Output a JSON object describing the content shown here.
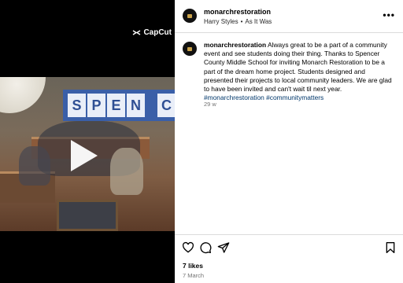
{
  "media": {
    "watermark": "CapCut",
    "banner_letters": [
      "S",
      "P",
      "E",
      "N"
    ],
    "banner_tail": "C",
    "play_icon": "play-icon"
  },
  "header": {
    "username": "monarchrestoration",
    "audio": "Harry Styles",
    "separator": "•",
    "audio_title": "As It Was",
    "more_icon": "more-options-icon"
  },
  "caption": {
    "username": "monarchrestoration",
    "text": "Always great to be a part of a community event and see students doing their thing. Thanks to Spencer County Middle School for inviting Monarch Restoration to be a part of the dream home project. Students designed and presented their projects to local community leaders. We are glad to have been invited and can't wait til next year.",
    "hashtags": [
      "#monarchrestoration",
      "#communitymatters"
    ],
    "time": "29 w"
  },
  "actions": {
    "like_icon": "heart-icon",
    "comment_icon": "comment-icon",
    "share_icon": "share-icon",
    "save_icon": "bookmark-icon"
  },
  "footer": {
    "likes": "7 likes",
    "date": "7 March"
  },
  "colors": {
    "hashtag": "#00376b",
    "secondary_text": "#737373",
    "divider": "#dbdbdb",
    "banner_blue": "#3a5fa8"
  }
}
